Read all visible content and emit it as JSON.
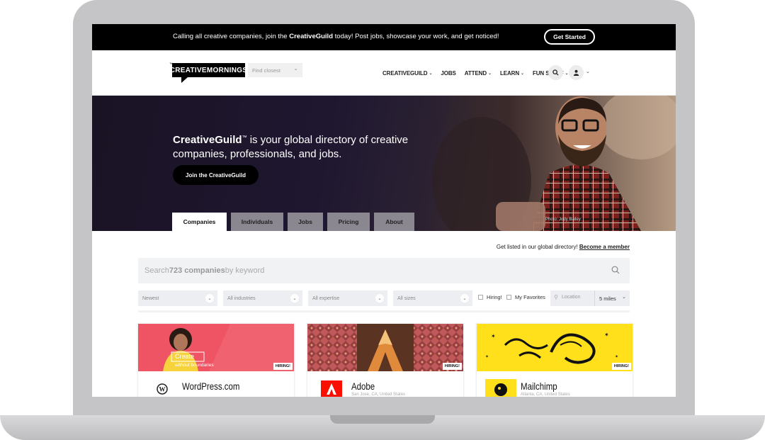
{
  "announcement": {
    "text_before": "Calling all creative companies, join the ",
    "text_bold": "CreativeGuild",
    "text_after": " today! Post jobs, showcase your work, and get noticed!",
    "cta": "Get Started"
  },
  "header": {
    "logo_text": "CREATIVEMORNINGS",
    "logo_tm": "™",
    "find_closest": "Find closest",
    "nav": [
      "CREATIVEGUILD",
      "JOBS",
      "ATTEND",
      "LEARN",
      "FUN STUFF"
    ],
    "nav_has_caret": [
      true,
      false,
      true,
      true,
      true
    ]
  },
  "hero": {
    "title_bold": "CreativeGuild",
    "title_tm": "™",
    "title_rest": " is your global directory of creative companies, professionals, and jobs.",
    "join_button": "Join the CreativeGuild",
    "photo_credit": "Photo: Jody Bailey",
    "tabs": [
      "Companies",
      "Individuals",
      "Jobs",
      "Pricing",
      "About"
    ],
    "active_tab": "Companies"
  },
  "directory": {
    "listed_text": "Get listed in our global directory! ",
    "listed_link": "Become a member",
    "search_prefix": "Search ",
    "search_count": "723 companies",
    "search_suffix": " by keyword",
    "filters": {
      "sort": "Newest",
      "industries": "All industries",
      "expertise": "All expertise",
      "sizes": "All sizes",
      "hiring": "Hiring!",
      "favorites": "My Favorites",
      "location_placeholder": "Location",
      "radius": "5 miles"
    }
  },
  "cards": [
    {
      "name": "WordPress.com",
      "location": "",
      "badge": "HIRING!",
      "banner_text1": "Create",
      "banner_text2": "without boundaries"
    },
    {
      "name": "Adobe",
      "location": "San Jose, CA, United States",
      "badge": "HIRING!"
    },
    {
      "name": "Mailchimp",
      "location": "Atlanta, CA, United States",
      "badge": "HIRING!"
    }
  ],
  "colors": {
    "announce_bg": "#000000",
    "hero_bg": "#1f1730",
    "tab_inactive": "#8b8790",
    "wordpress_banner": "#ef5464",
    "adobe_banner": "#c0595a",
    "mailchimp_banner": "#ffe01b"
  }
}
